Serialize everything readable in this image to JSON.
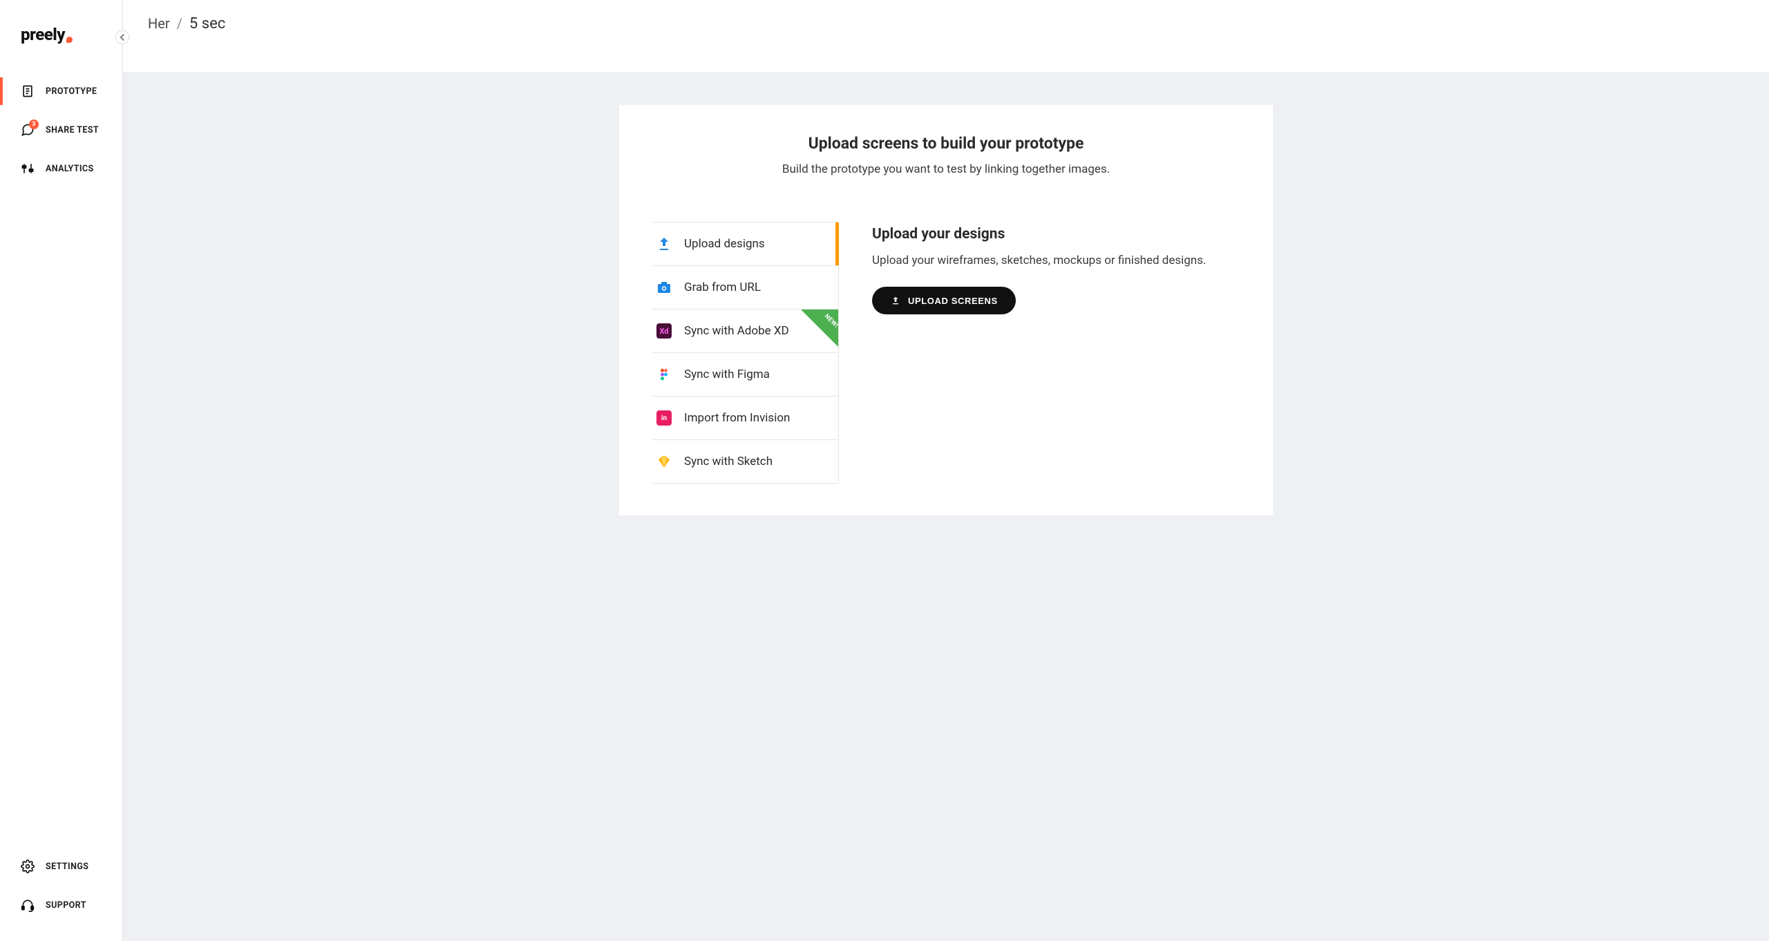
{
  "brand": {
    "name": "preely"
  },
  "breadcrumb": {
    "parent": "Her",
    "sep": "/",
    "current": "5 sec"
  },
  "sidebar": {
    "items": [
      {
        "label": "PROTOTYPE",
        "icon": "document-icon",
        "active": true
      },
      {
        "label": "SHARE TEST",
        "icon": "chat-icon",
        "badge": "3"
      },
      {
        "label": "ANALYTICS",
        "icon": "sliders-icon"
      }
    ],
    "bottom": [
      {
        "label": "SETTINGS",
        "icon": "gear-icon"
      },
      {
        "label": "SUPPORT",
        "icon": "headset-icon"
      }
    ]
  },
  "panel": {
    "title": "Upload screens to build your prototype",
    "subtitle": "Build the prototype you want to test by linking together images."
  },
  "options": [
    {
      "label": "Upload designs",
      "icon": "upload-icon",
      "active": true
    },
    {
      "label": "Grab from URL",
      "icon": "camera-icon"
    },
    {
      "label": "Sync with Adobe XD",
      "icon": "adobe-xd-icon",
      "new": true,
      "new_label": "NEW!"
    },
    {
      "label": "Sync with Figma",
      "icon": "figma-icon"
    },
    {
      "label": "Import from Invision",
      "icon": "invision-icon"
    },
    {
      "label": "Sync with Sketch",
      "icon": "sketch-icon"
    }
  ],
  "detail": {
    "title": "Upload your designs",
    "body": "Upload your wireframes, sketches, mockups or finished designs.",
    "button": "UPLOAD SCREENS"
  }
}
